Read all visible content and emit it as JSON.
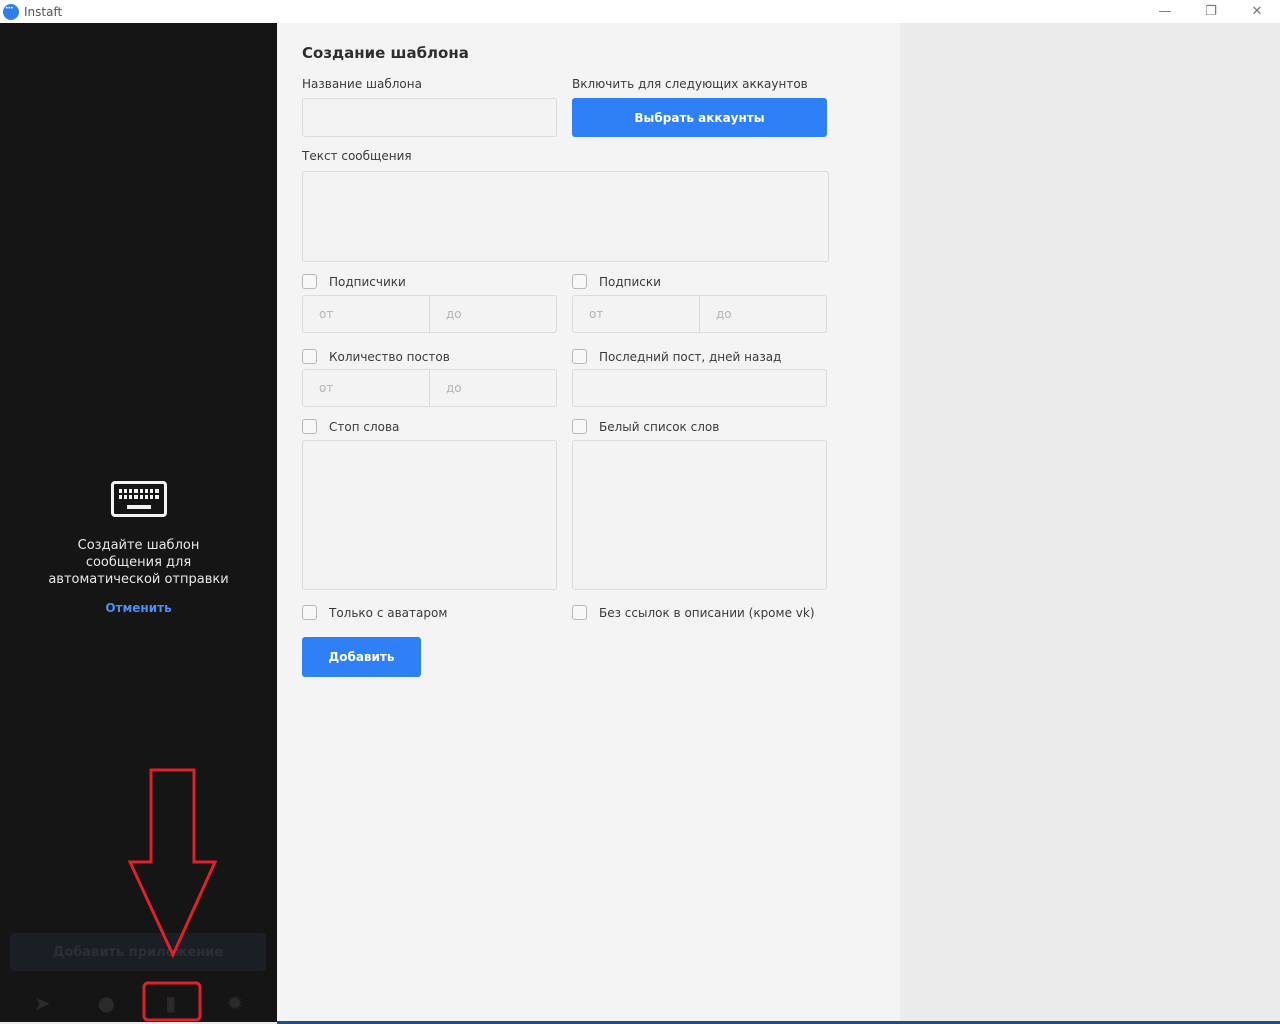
{
  "window": {
    "title": "Instaft",
    "minimize_glyph": "—",
    "restore_glyph": "❐",
    "close_glyph": "✕"
  },
  "sidebar": {
    "placeholder_text": "Создайте шаблон сообщения для автоматической отправки",
    "cancel_label": "Отменить",
    "add_account_label": "Добавить приложение",
    "nav": [
      {
        "icon": "send-icon",
        "glyph": "➤"
      },
      {
        "icon": "user-icon",
        "glyph": "●"
      },
      {
        "icon": "chat-icon",
        "glyph": "▮"
      },
      {
        "icon": "gear-icon",
        "glyph": "✹"
      }
    ]
  },
  "form": {
    "title": "Создание шаблона",
    "template_name_label": "Название шаблона",
    "template_name_value": "",
    "accounts_label": "Включить для следующих аккаунтов",
    "select_accounts_label": "Выбрать аккаунты",
    "message_text_label": "Текст сообщения",
    "message_text_value": "",
    "followers_label": "Подписчики",
    "following_label": "Подписки",
    "posts_count_label": "Количество постов",
    "last_post_label": "Последний пост, дней назад",
    "from_placeholder": "от",
    "to_placeholder": "до",
    "stop_words_label": "Стоп слова",
    "white_list_label": "Белый список слов",
    "avatar_only_label": "Только с аватаром",
    "no_links_label": "Без ссылок в описании (кроме vk)",
    "add_label": "Добавить"
  },
  "colors": {
    "accent": "#2f80f7",
    "sidebar_bg": "#151515",
    "annotation_red": "#e0202a"
  }
}
